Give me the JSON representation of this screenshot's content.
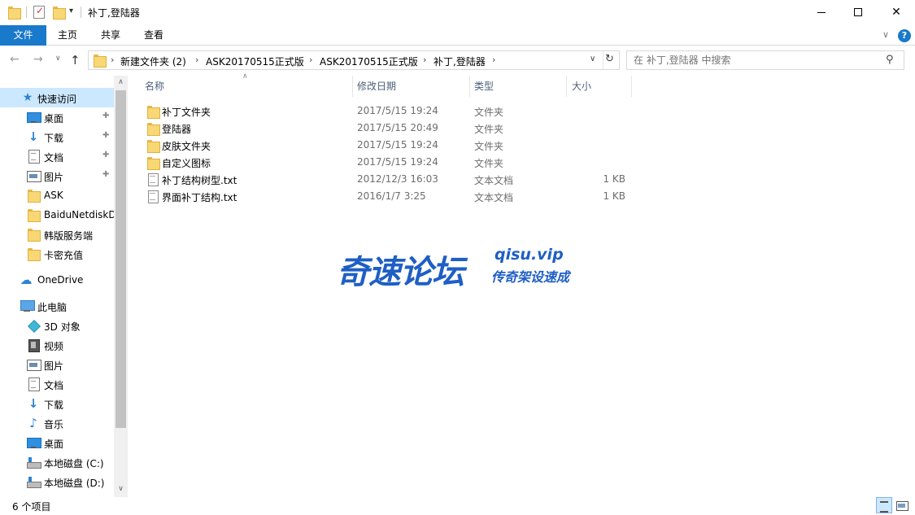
{
  "window": {
    "title": "补丁,登陆器",
    "qa_dropdown_glyph": "▾",
    "min_icon": "minimize-icon",
    "max_icon": "maximize-icon",
    "close_glyph": "✕"
  },
  "ribbon": {
    "tabs": [
      "文件",
      "主页",
      "共享",
      "查看"
    ],
    "expand_glyph": "∨",
    "help_glyph": "?"
  },
  "nav": {
    "back_glyph": "←",
    "forward_glyph": "→",
    "recent_glyph": "∨",
    "up_glyph": "↑",
    "breadcrumb": [
      "新建文件夹 (2)",
      "ASK20170515正式版",
      "ASK20170515正式版",
      "补丁,登陆器"
    ],
    "crumb_sep": "›",
    "address_dropdown_glyph": "∨",
    "refresh_glyph": "↻",
    "search_placeholder": "在 补丁,登陆器 中搜索",
    "search_glyph": "⚲"
  },
  "sidebar": {
    "pin_glyph": "📌",
    "scroll_up_glyph": "∧",
    "scroll_down_glyph": "∨",
    "items": [
      {
        "label": "快速访问",
        "icon": "star-icon",
        "state": "selected"
      },
      {
        "label": "桌面",
        "icon": "desktop-icon",
        "pinned": true
      },
      {
        "label": "下载",
        "icon": "download-icon",
        "pinned": true
      },
      {
        "label": "文档",
        "icon": "document-icon",
        "pinned": true
      },
      {
        "label": "图片",
        "icon": "picture-icon",
        "pinned": true
      },
      {
        "label": "ASK",
        "icon": "folder-icon"
      },
      {
        "label": "BaiduNetdiskD",
        "icon": "folder-icon"
      },
      {
        "label": "韩版服务端",
        "icon": "folder-icon"
      },
      {
        "label": "卡密充值",
        "icon": "folder-icon"
      },
      {
        "label": "OneDrive",
        "icon": "onedrive-icon"
      },
      {
        "label": "此电脑",
        "icon": "pc-icon"
      },
      {
        "label": "3D 对象",
        "icon": "3d-objects-icon"
      },
      {
        "label": "视频",
        "icon": "video-icon"
      },
      {
        "label": "图片",
        "icon": "picture-icon"
      },
      {
        "label": "文档",
        "icon": "document-icon"
      },
      {
        "label": "下载",
        "icon": "download-icon"
      },
      {
        "label": "音乐",
        "icon": "music-icon"
      },
      {
        "label": "桌面",
        "icon": "desktop-icon"
      },
      {
        "label": "本地磁盘 (C:)",
        "icon": "drive-icon"
      },
      {
        "label": "本地磁盘 (D:)",
        "icon": "drive-icon"
      }
    ]
  },
  "filelist": {
    "columns": [
      "名称",
      "修改日期",
      "类型",
      "大小"
    ],
    "sort_glyph": "∧",
    "rows": [
      {
        "name": "补丁文件夹",
        "date": "2017/5/15 19:24",
        "type": "文件夹",
        "size": "",
        "icon": "folder-icon"
      },
      {
        "name": "登陆器",
        "date": "2017/5/15 20:49",
        "type": "文件夹",
        "size": "",
        "icon": "folder-icon"
      },
      {
        "name": "皮肤文件夹",
        "date": "2017/5/15 19:24",
        "type": "文件夹",
        "size": "",
        "icon": "folder-icon"
      },
      {
        "name": "自定义图标",
        "date": "2017/5/15 19:24",
        "type": "文件夹",
        "size": "",
        "icon": "folder-icon"
      },
      {
        "name": "补丁结构树型.txt",
        "date": "2012/12/3 16:03",
        "type": "文本文档",
        "size": "1 KB",
        "icon": "text-file-icon"
      },
      {
        "name": "界面补丁结构.txt",
        "date": "2016/1/7 3:25",
        "type": "文本文档",
        "size": "1 KB",
        "icon": "text-file-icon"
      }
    ]
  },
  "watermark": {
    "main": "奇速论坛",
    "url": "qisu.vip",
    "sub": "传奇架设速成",
    "color": "#1f5fc4"
  },
  "status": {
    "count": "6 个项目"
  },
  "colors": {
    "accent": "#1979ca",
    "selected_bg": "#cce8ff",
    "folder": "#f8d775"
  }
}
